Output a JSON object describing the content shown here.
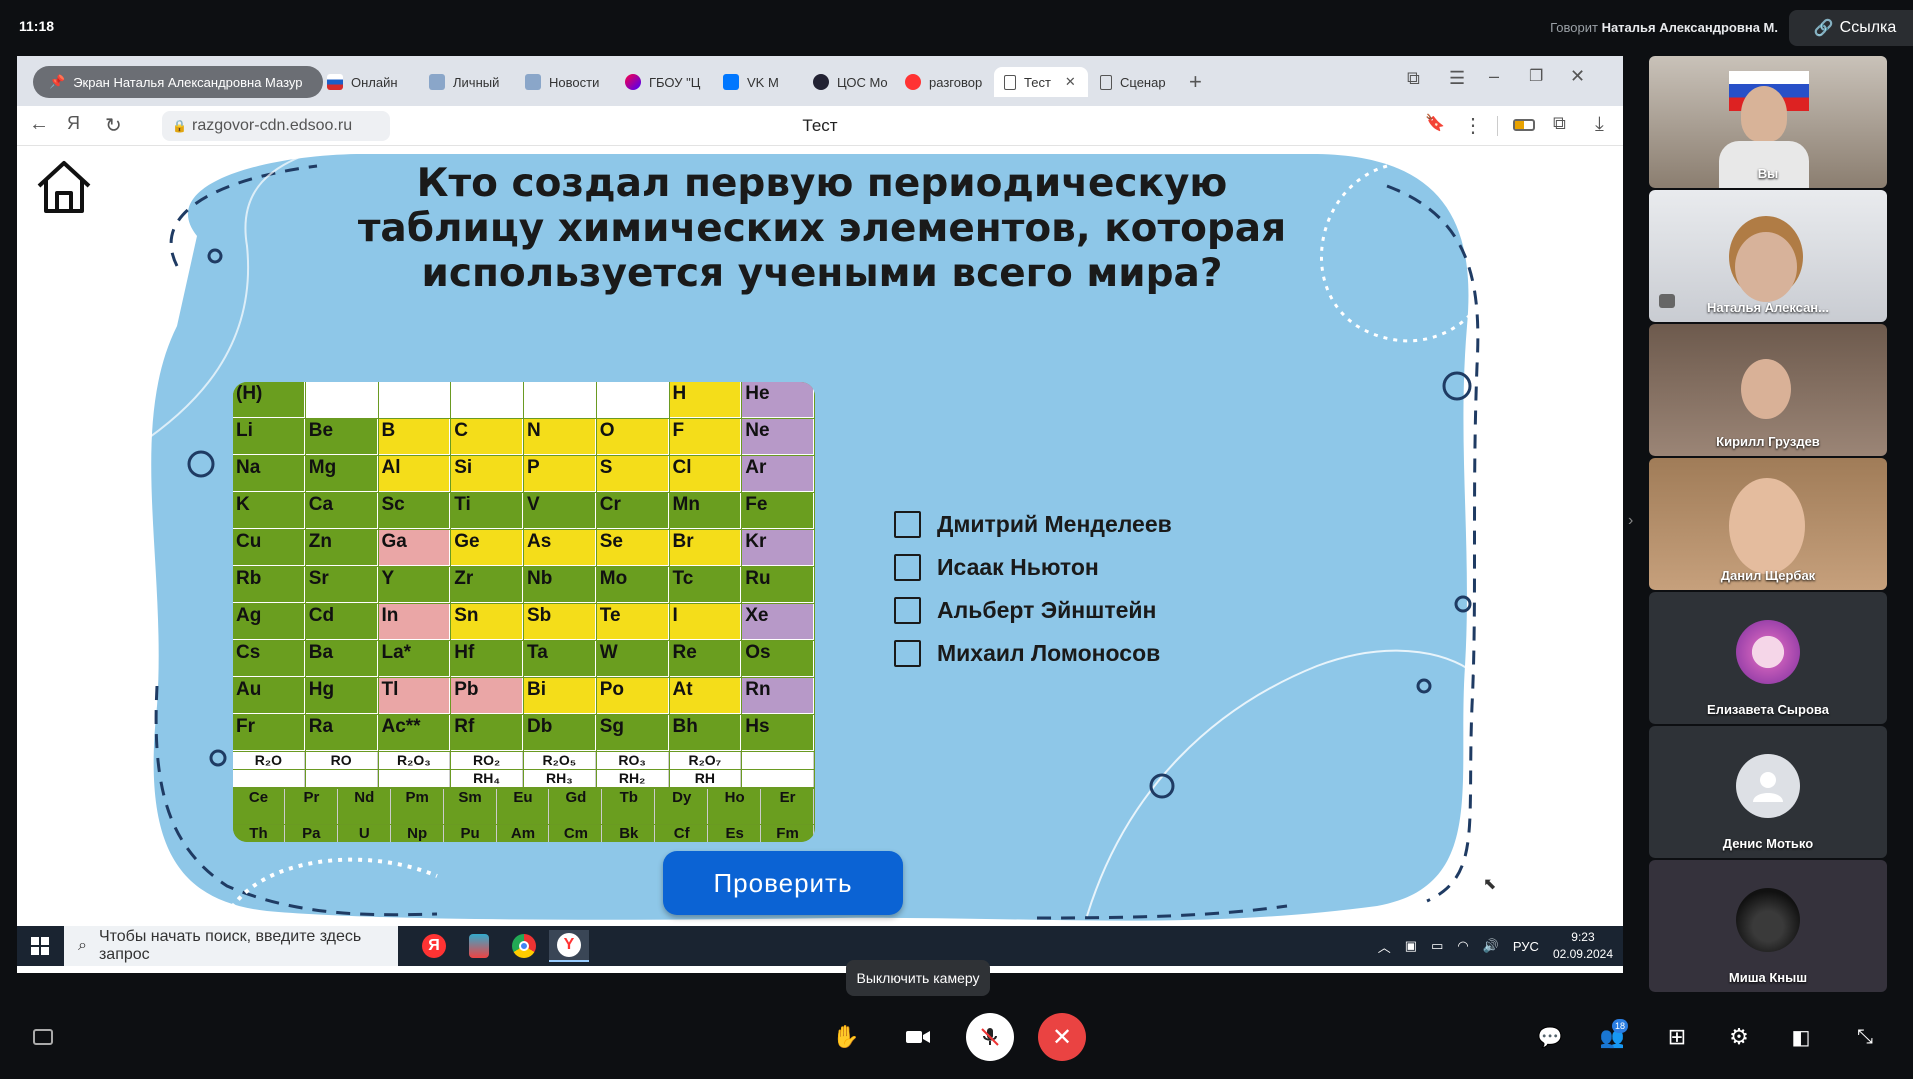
{
  "meeting": {
    "clock": "11:18",
    "speaker_prefix": "Говорит",
    "speaker_name": "Наталья Александровна М.",
    "link_label": "Ссылка"
  },
  "browser": {
    "share_label": "Экран Наталья Александровна Мазур",
    "share_sub": "Экран",
    "tabs": [
      "Онлайн",
      "Личный",
      "Новости",
      "ГБОУ \"Ц",
      "VK M",
      "ЦОС Мо",
      "разговор",
      "Тест",
      "Сценар"
    ],
    "active_tab": "Тест",
    "url": "razgovor-cdn.edsoo.ru",
    "title": "Тест"
  },
  "quiz": {
    "question": "Кто создал первую периодическую таблицу химических элементов, которая используется учеными всего мира?",
    "answers": [
      "Дмитрий Менделеев",
      "Исаак Ньютон",
      "Альберт Эйнштейн",
      "Михаил Ломоносов"
    ],
    "check_label": "Проверить"
  },
  "periodic_table": {
    "rows": [
      [
        "(H)",
        "",
        "",
        "",
        "",
        "",
        "H",
        "He"
      ],
      [
        "Li",
        "Be",
        "B",
        "C",
        "N",
        "O",
        "F",
        "Ne"
      ],
      [
        "Na",
        "Mg",
        "Al",
        "Si",
        "P",
        "S",
        "Cl",
        "Ar"
      ],
      [
        "K",
        "Ca",
        "Sc",
        "Ti",
        "V",
        "Cr",
        "Mn",
        "Fe"
      ],
      [
        "Cu",
        "Zn",
        "Ga",
        "Ge",
        "As",
        "Se",
        "Br",
        "Kr"
      ],
      [
        "Rb",
        "Sr",
        "Y",
        "Zr",
        "Nb",
        "Mo",
        "Tc",
        "Ru"
      ],
      [
        "Ag",
        "Cd",
        "In",
        "Sn",
        "Sb",
        "Te",
        "I",
        "Xe"
      ],
      [
        "Cs",
        "Ba",
        "La*",
        "Hf",
        "Ta",
        "W",
        "Re",
        "Os"
      ],
      [
        "Au",
        "Hg",
        "Tl",
        "Pb",
        "Bi",
        "Po",
        "At",
        "Rn"
      ],
      [
        "Fr",
        "Ra",
        "Ac**",
        "Rf",
        "Db",
        "Sg",
        "Bh",
        "Hs"
      ]
    ],
    "oxides": [
      "R₂O",
      "RO",
      "R₂O₃",
      "RO₂",
      "R₂O₅",
      "RO₃",
      "R₂O₇",
      ""
    ],
    "hydrides": [
      "",
      "",
      "",
      "RH₄",
      "RH₃",
      "RH₂",
      "RH",
      ""
    ],
    "lanthanides": [
      "Ce",
      "Pr",
      "Nd",
      "Pm",
      "Sm",
      "Eu",
      "Gd",
      "Tb",
      "Dy",
      "Ho",
      "Er"
    ],
    "actinides": [
      "Th",
      "Pa",
      "U",
      "Np",
      "Pu",
      "Am",
      "Cm",
      "Bk",
      "Cf",
      "Es",
      "Fm"
    ]
  },
  "taskbar": {
    "search_placeholder": "Чтобы начать поиск, введите здесь запрос",
    "lang": "РУС",
    "time": "9:23",
    "date": "02.09.2024"
  },
  "participants": [
    {
      "name": "Вы"
    },
    {
      "name": "Наталья Алексан..."
    },
    {
      "name": "Кирилл Груздев"
    },
    {
      "name": "Данил Щербак"
    },
    {
      "name": "Елизавета Сырова"
    },
    {
      "name": "Денис Мотько"
    },
    {
      "name": "Миша Кныш"
    }
  ],
  "controls": {
    "tooltip": "Выключить камеру",
    "participants_count": "18"
  }
}
